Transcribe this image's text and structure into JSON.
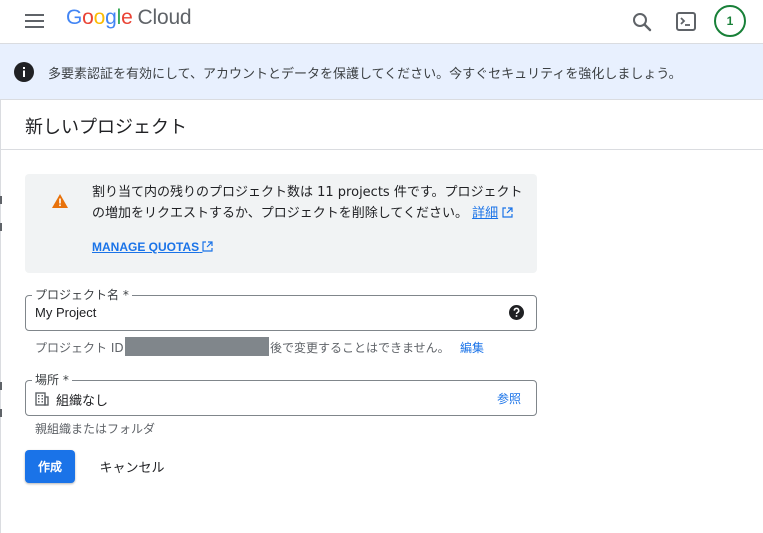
{
  "header": {
    "logo_google": "Google",
    "logo_cloud": "Cloud",
    "avatar_label": "1"
  },
  "banner": {
    "text": "多要素認証を有効にして、アカウントとデータを保護してください。今すぐセキュリティを強化しましょう。"
  },
  "page": {
    "title": "新しいプロジェクト"
  },
  "quota": {
    "text": "割り当て内の残りのプロジェクト数は 11 projects 件です。プロジェクトの増加をリクエストするか、プロジェクトを削除してください。",
    "details_link": "詳細",
    "manage_link": "MANAGE QUOTAS"
  },
  "project_name": {
    "label": "プロジェクト名 *",
    "value": "My Project",
    "id_prefix": "プロジェクト ID:",
    "id_suffix": "後で変更することはできません。",
    "edit_link": "編集"
  },
  "location": {
    "label": "場所 *",
    "value": "組織なし",
    "browse_link": "参照",
    "hint": "親組織またはフォルダ"
  },
  "actions": {
    "create": "作成",
    "cancel": "キャンセル"
  },
  "colors": {
    "accent": "#1a73e8",
    "banner_bg": "#e8f0fe",
    "warning": "#e8710a",
    "avatar": "#188038"
  },
  "icons": {
    "menu": "hamburger-menu-icon",
    "search": "search-icon",
    "terminal": "cloud-shell-terminal-icon",
    "info": "info-icon",
    "warning": "warning-triangle-icon",
    "external": "external-link-icon",
    "help": "help-circle-icon",
    "building": "organization-building-icon"
  }
}
